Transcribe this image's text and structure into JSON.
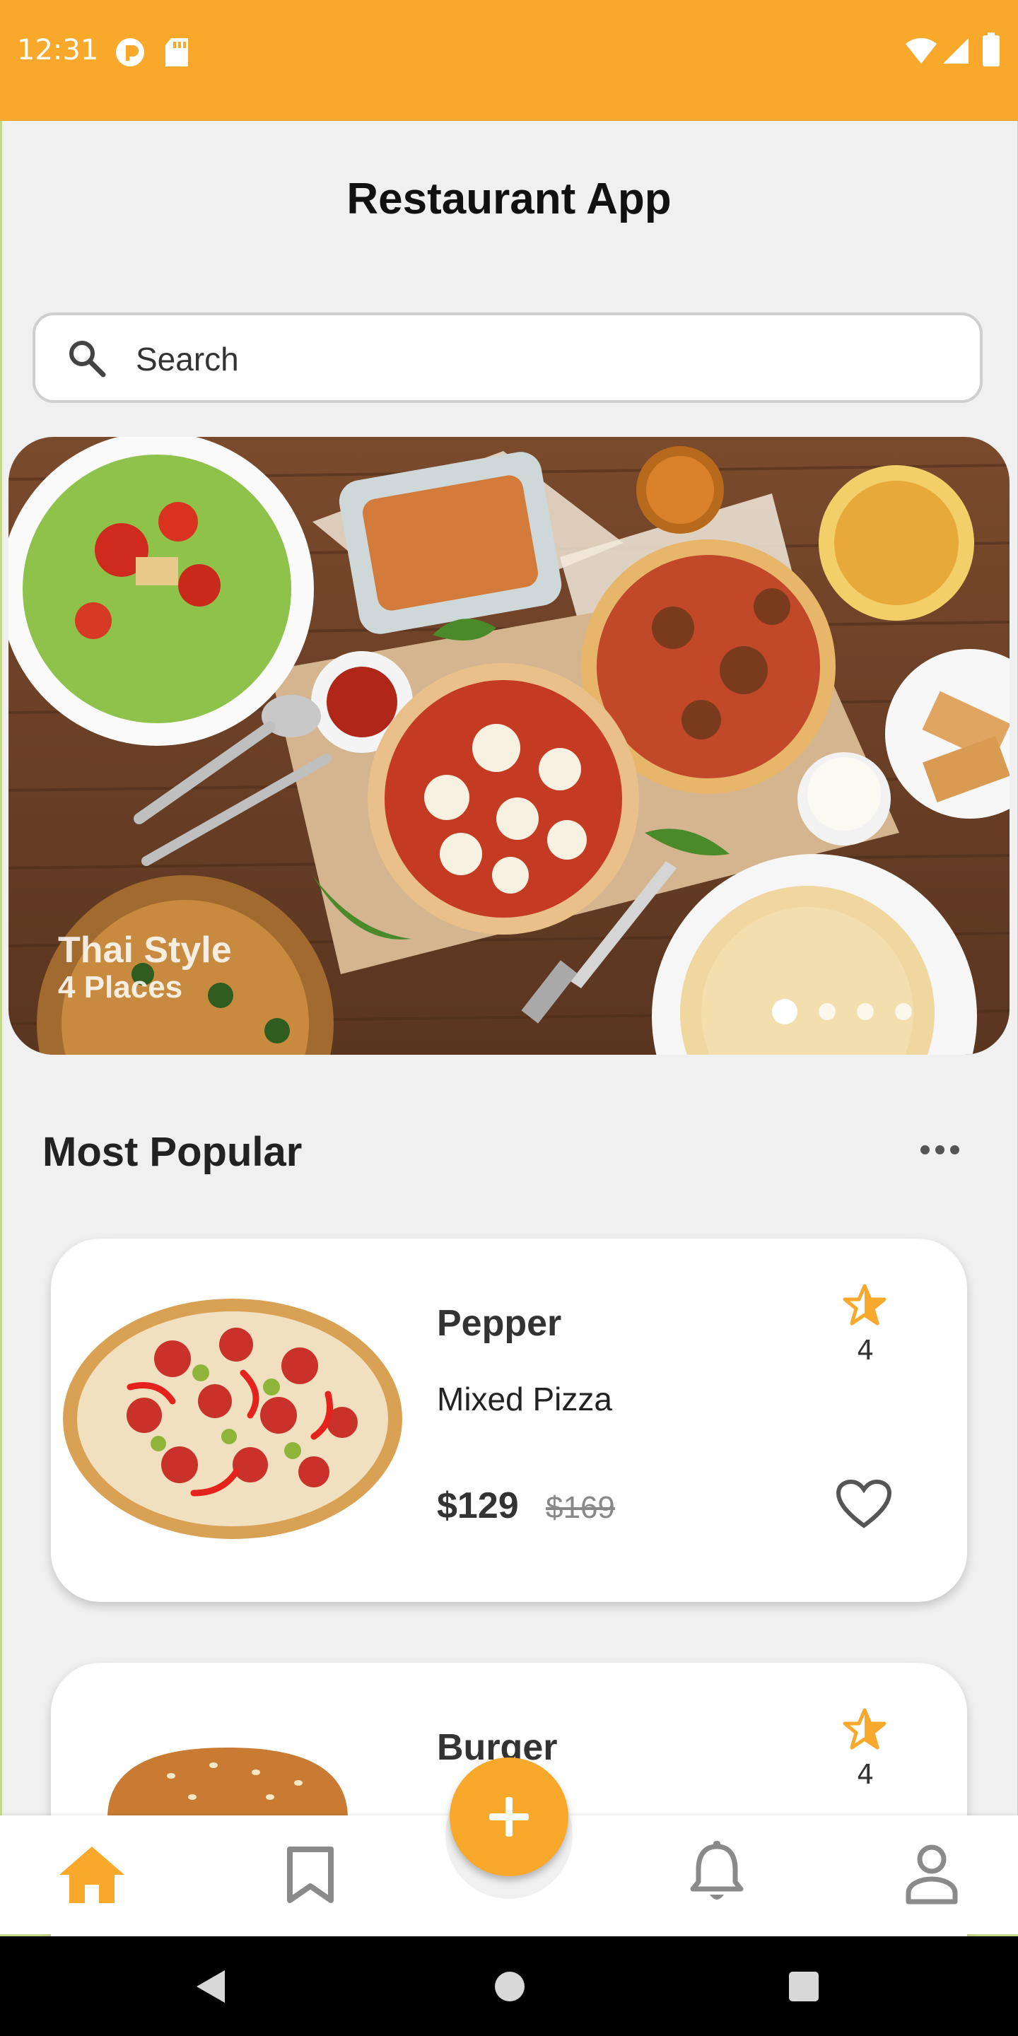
{
  "status_bar": {
    "time": "12:31"
  },
  "header": {
    "title": "Restaurant App"
  },
  "search": {
    "placeholder": "Search"
  },
  "hero": {
    "title": "Thai Style",
    "subtitle": "4 Places",
    "slide_count": 4,
    "active_slide": 1
  },
  "section": {
    "title": "Most Popular"
  },
  "items": [
    {
      "name": "Pepper",
      "description": "Mixed Pizza",
      "price": "$129",
      "old_price": "$169",
      "rating": "4"
    },
    {
      "name": "Burger",
      "rating": "4"
    }
  ],
  "bottom_nav": [
    "home-icon",
    "bookmark-icon",
    "add-icon",
    "bell-icon",
    "profile-icon"
  ],
  "colors": {
    "accent": "#f8a82b",
    "background": "#f0f0f0"
  }
}
